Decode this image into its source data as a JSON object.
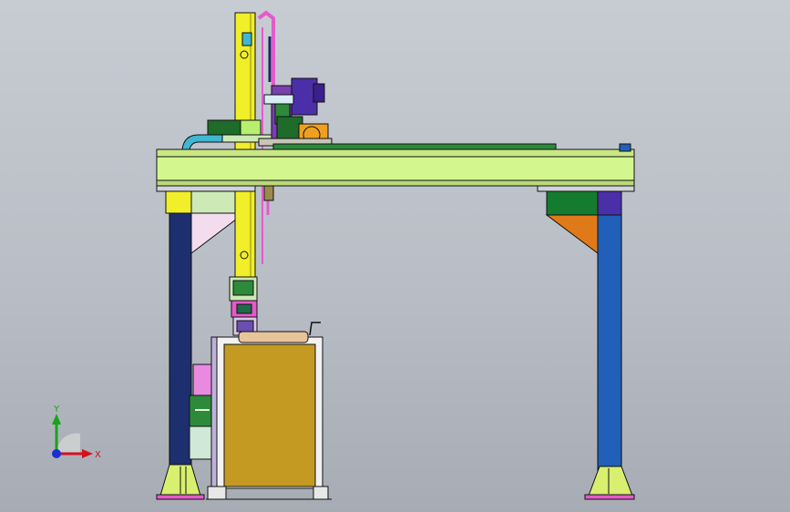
{
  "viewport": {
    "background_top": "#c7ccd3",
    "background_bottom": "#a7acb4"
  },
  "triad": {
    "x_label": "X",
    "y_label": "Y",
    "x_color": "#d4121c",
    "y_color": "#1aa31a",
    "z_color": "#1b2fd0"
  },
  "colors": {
    "beam": "#d3f78e",
    "column_left": "#1d2f6e",
    "column_right": "#2160b8",
    "mast": "#f1ee2a",
    "cabinet": "#c49a22",
    "gusset_left": "#f1d9ef",
    "gusset_right": "#e07a18",
    "block_green": "#157b2f",
    "block_purple": "#4b2fa8",
    "accent_pink": "#e45acb",
    "motor_orange": "#f0a020",
    "pipe_cyan": "#3fb7d0"
  }
}
